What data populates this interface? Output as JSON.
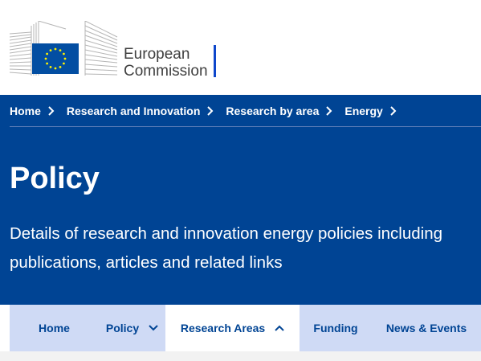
{
  "logo": {
    "line1": "European",
    "line2": "Commission"
  },
  "breadcrumb": [
    {
      "label": "Home"
    },
    {
      "label": "Research and Innovation"
    },
    {
      "label": "Research by area"
    },
    {
      "label": "Energy"
    }
  ],
  "hero": {
    "title": "Policy",
    "description_line1": "Details of research and innovation energy policies including",
    "description_line2": "publications, articles and related links"
  },
  "nav": {
    "items": [
      {
        "label": "Home"
      },
      {
        "label": "Policy",
        "icon": "chevron-down-icon"
      },
      {
        "label": "Research Areas",
        "icon": "chevron-up-icon"
      },
      {
        "label": "Funding"
      },
      {
        "label": "News & Events"
      }
    ]
  },
  "colors": {
    "primary": "#004494",
    "nav_bg": "#cfdaf5",
    "eu_flag": "#034ea2",
    "eu_stars": "#fff200"
  }
}
